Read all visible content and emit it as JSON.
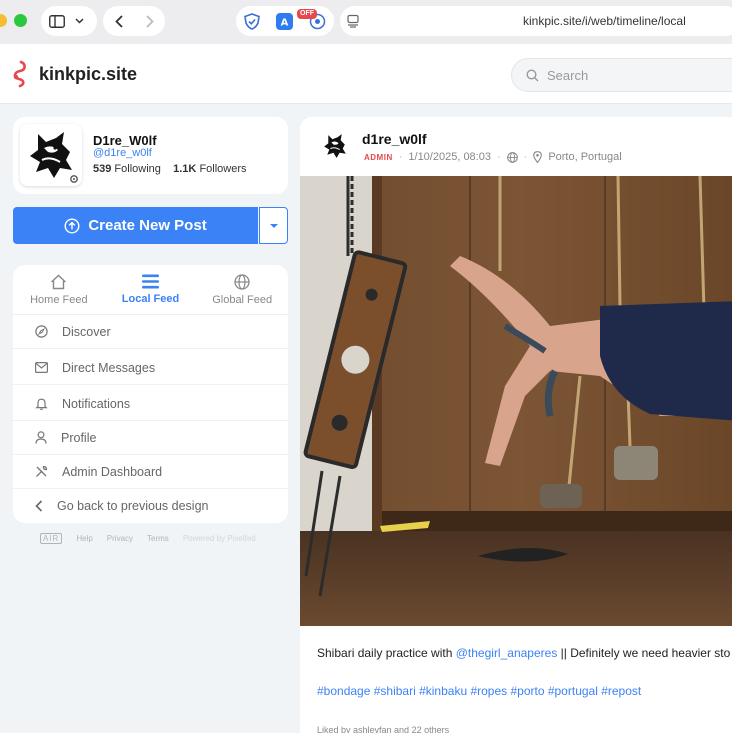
{
  "browser": {
    "url": "kinkpic.site/i/web/timeline/local",
    "extension_badge": "OFF"
  },
  "header": {
    "site_name": "kinkpic.site",
    "search_placeholder": "Search"
  },
  "profile": {
    "name": "D1re_W0lf",
    "handle": "@d1re_w0lf",
    "following_count": "539",
    "following_label": "Following",
    "followers_count": "1.1K",
    "followers_label": "Followers"
  },
  "create_post": {
    "label": "Create New Post"
  },
  "feed_tabs": [
    {
      "label": "Home Feed",
      "icon": "home-icon",
      "active": false
    },
    {
      "label": "Local Feed",
      "icon": "list-icon",
      "active": true
    },
    {
      "label": "Global Feed",
      "icon": "globe-icon",
      "active": false
    }
  ],
  "menu": [
    {
      "label": "Discover",
      "icon": "compass-icon"
    },
    {
      "label": "Direct Messages",
      "icon": "mail-icon"
    },
    {
      "label": "Notifications",
      "icon": "bell-icon"
    },
    {
      "label": "Profile",
      "icon": "user-icon"
    },
    {
      "label": "Admin Dashboard",
      "icon": "tools-icon"
    },
    {
      "label": "Go back to previous design",
      "icon": "chevron-left-icon"
    }
  ],
  "footer": {
    "air": "AIR",
    "help": "Help",
    "privacy": "Privacy",
    "terms": "Terms",
    "powered": "Powered by Pixelfed"
  },
  "post": {
    "username": "d1re_w0lf",
    "badge": "ADMIN",
    "date": "1/10/2025, 08:03",
    "location": "Porto, Portugal",
    "caption_start": "Shibari daily practice with ",
    "caption_mention": "@thegirl_anaperes",
    "caption_end": " || Definitely we need heavier sto",
    "hashtags": "#bondage #shibari #kinbaku #ropes #porto #portugal #repost",
    "liked_by": "Liked by ashleyfan and 22 others"
  },
  "colors": {
    "accent": "#3b82f6",
    "admin_badge": "#e5484d",
    "background": "#f1f4f7"
  }
}
